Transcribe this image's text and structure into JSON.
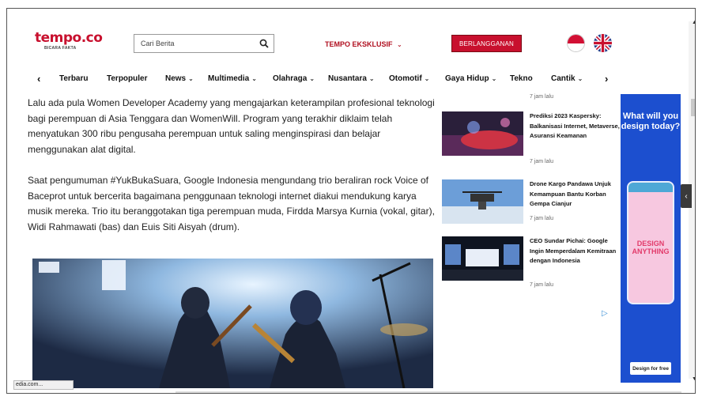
{
  "header": {
    "logo_text": "tempo.co",
    "logo_tagline": "BICARA FAKTA",
    "search_placeholder": "Cari Berita",
    "exclusive_label": "TEMPO EKSKLUSIF",
    "subscribe_label": "BERLANGGANAN"
  },
  "nav": {
    "items": [
      {
        "label": "Terbaru",
        "has_dropdown": false
      },
      {
        "label": "Terpopuler",
        "has_dropdown": false
      },
      {
        "label": "News",
        "has_dropdown": true
      },
      {
        "label": "Multimedia",
        "has_dropdown": true
      },
      {
        "label": "Olahraga",
        "has_dropdown": true
      },
      {
        "label": "Nusantara",
        "has_dropdown": true
      },
      {
        "label": "Otomotif",
        "has_dropdown": true
      },
      {
        "label": "Gaya Hidup",
        "has_dropdown": true
      },
      {
        "label": "Tekno",
        "has_dropdown": false
      },
      {
        "label": "Cantik",
        "has_dropdown": true
      }
    ]
  },
  "article": {
    "paragraphs": [
      "Lalu ada pula Women Developer Academy yang mengajarkan keterampilan profesional teknologi bagi perempuan di Asia Tenggara dan WomenWill. Program yang terakhir diklaim telah menyatukan 300 ribu pengusaha perempuan untuk saling menginspirasi dan belajar menggunakan alat digital.",
      "Saat pengumuman #YukBukaSuara, Google Indonesia mengundang trio beraliran rock Voice of Baceprot untuk bercerita bagaimana penggunaan teknologi internet diakui mendukung karya musik mereka. Trio itu beranggotakan tiga perempuan muda, Firdda Marsya Kurnia (vokal, gitar), Widi Rahmawati (bas) dan Euis Siti Aisyah (drum)."
    ]
  },
  "side_news": [
    {
      "title": "Prediksi 2023 Kaspersky: Balkanisasi Internet, Metaverse, Asuransi Keamanan",
      "time": "7 jam lalu"
    },
    {
      "title": "Drone Kargo Pandawa Unjuk Kemampuan Bantu Korban Gempa Cianjur",
      "time": "7 jam lalu"
    },
    {
      "title": "CEO Sundar Pichai: Google Ingin Memperdalam Kemitraan dengan Indonesia",
      "time": "7 jam lalu"
    }
  ],
  "side_top_time": "7 jam lalu",
  "ad": {
    "headline": "What will you design today?",
    "phone_text": "DESIGN ANYTHING",
    "cta": "Design for free"
  },
  "status_bar": "edia.com...",
  "colors": {
    "brand_red": "#c8102e",
    "ad_blue": "#1c4fcf"
  }
}
